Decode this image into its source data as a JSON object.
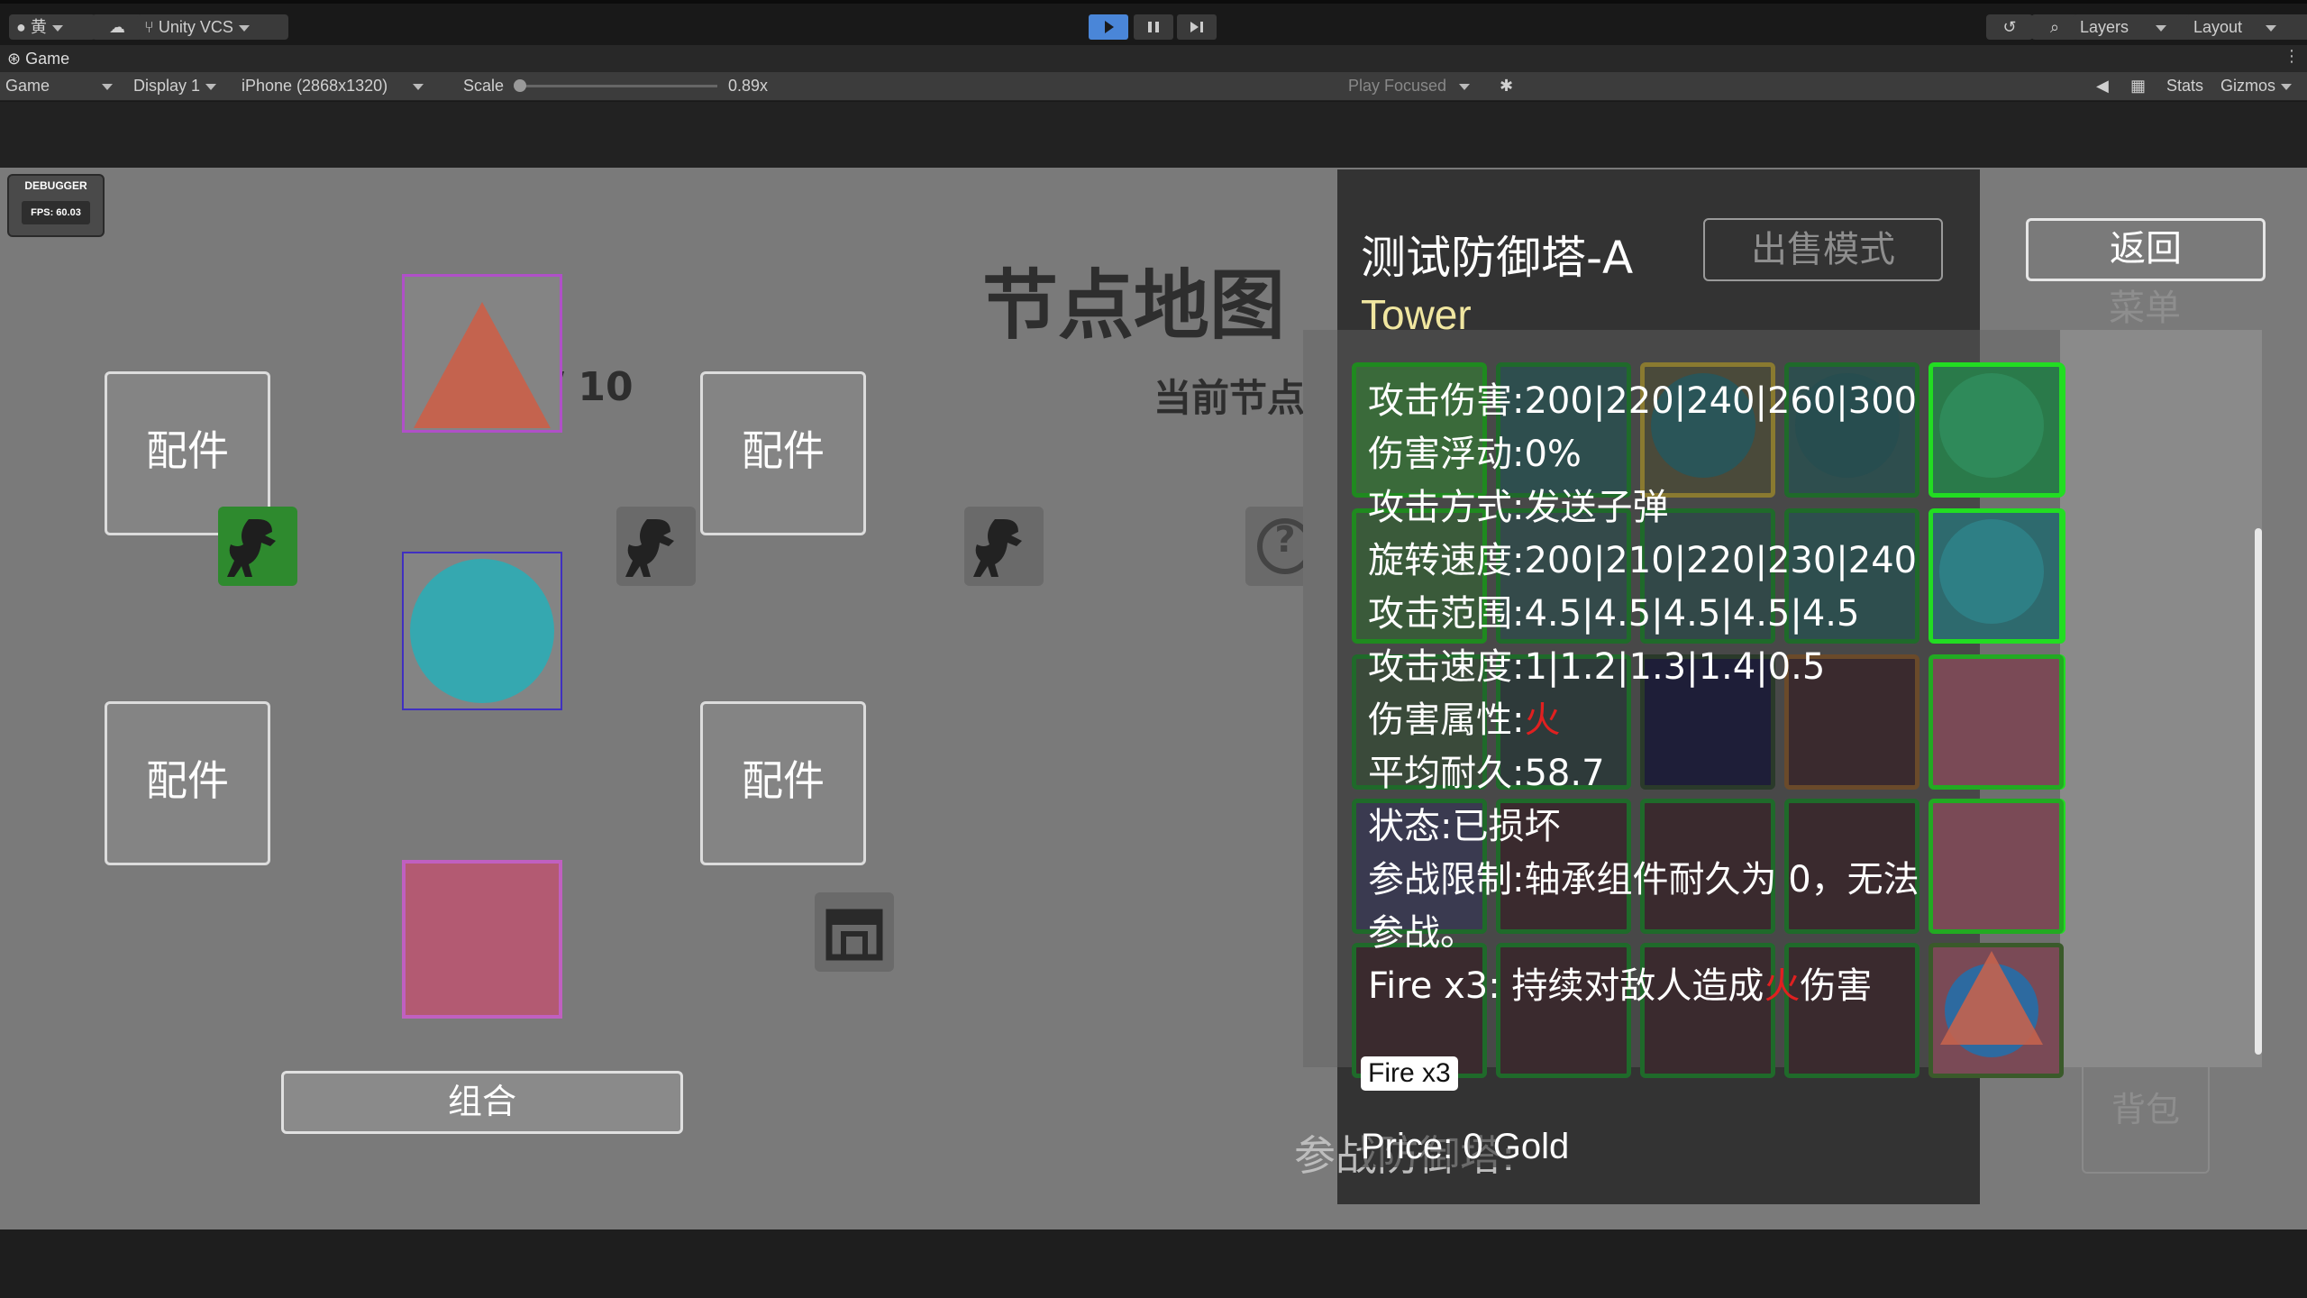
{
  "toolbar": {
    "account": "黄",
    "vcs": "Unity VCS",
    "layers": "Layers",
    "layout": "Layout"
  },
  "tab": {
    "label": "Game"
  },
  "gamebar": {
    "mode": "Game",
    "display": "Display 1",
    "resolution": "iPhone (2868x1320)",
    "scale_label": "Scale",
    "scale_value": "0.89x",
    "scale_level": 0.0,
    "play_focused": "Play Focused",
    "stats": "Stats",
    "gizmos": "Gizmos"
  },
  "debugger": {
    "title": "DEBUGGER",
    "fps": "FPS: 60.03"
  },
  "scene": {
    "title": "节点地图",
    "counter": "/ 10",
    "current_node": "当前节点:",
    "part_label": "配件",
    "combine": "组合",
    "back": "返回",
    "menu": "菜单",
    "backpack": "背包",
    "bottom_text": "参战防御塔:",
    "node_hint": "?"
  },
  "popup": {
    "name": "测试防御塔-A",
    "type": "Tower",
    "sell_mode": "出售模式",
    "stats": [
      {
        "label": "攻击伤害:",
        "value": "200|220|240|260|300"
      },
      {
        "label": "伤害浮动:",
        "value": "0%"
      },
      {
        "label": "攻击方式:",
        "value": "发送子弹"
      },
      {
        "label": "旋转速度:",
        "value": "200|210|220|230|240"
      },
      {
        "label": "攻击范围:",
        "value": "4.5|4.5|4.5|4.5|4.5"
      },
      {
        "label": "攻击速度:",
        "value": "1|1.2|1.3|1.4|0.5"
      },
      {
        "label": "伤害属性:",
        "value": "火"
      },
      {
        "label": "平均耐久:",
        "value": "58.7"
      },
      {
        "label": "状态:",
        "value": "已损坏"
      },
      {
        "label": "参战限制:",
        "value": "轴承组件耐久为 0，无法"
      },
      {
        "label": "",
        "value": "参战。"
      }
    ],
    "effect_prefix": "Fire x3: 持续对敌人造成",
    "effect_element": "火",
    "effect_suffix": "伤害",
    "tag": "Fire x3",
    "price": "Price: 0 Gold",
    "element_color": "#e02020"
  },
  "colors": {
    "accent_green": "#22dd22",
    "teal": "#35a8b0",
    "pink": "#b35a72",
    "purple": "#5a3da0",
    "orange": "#c4634e"
  }
}
